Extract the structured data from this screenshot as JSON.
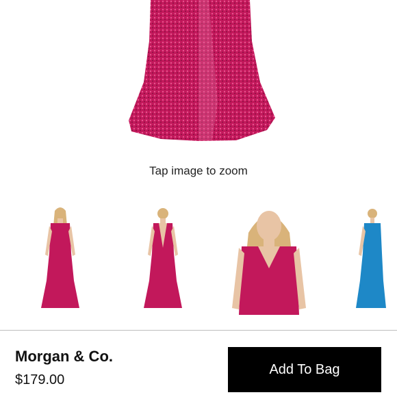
{
  "product": {
    "zoom_hint": "Tap image to zoom",
    "brand": "Morgan & Co.",
    "price": "$179.00",
    "add_to_bag_label": "Add To Bag"
  },
  "gallery": {
    "thumbnails": [
      {
        "view": "front-full",
        "color": "#c2185b"
      },
      {
        "view": "back-full",
        "color": "#c2185b"
      },
      {
        "view": "front-close-up",
        "color": "#c2185b"
      },
      {
        "view": "front-full",
        "color": "#1e88c7"
      }
    ]
  },
  "colors": {
    "primary_button": "#000000",
    "dress_pink": "#c2185b",
    "dress_blue": "#1e88c7"
  }
}
